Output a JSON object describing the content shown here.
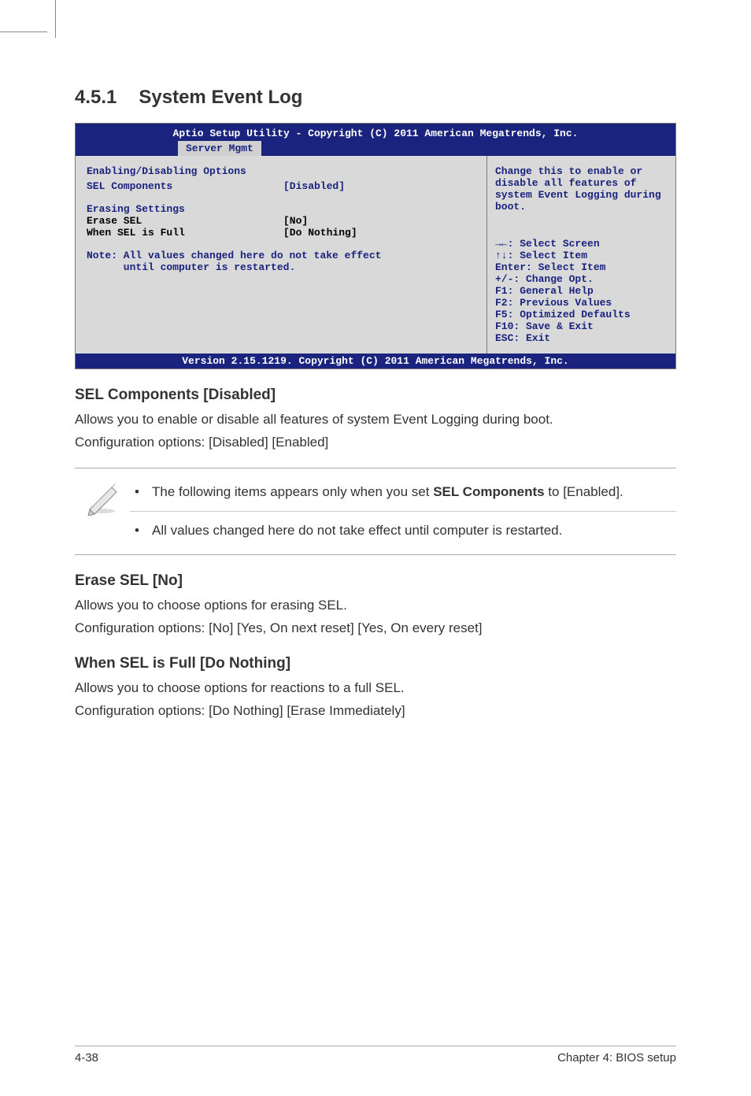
{
  "section": {
    "number": "4.5.1",
    "title": "System Event Log"
  },
  "bios": {
    "header_line1": "Aptio Setup Utility - Copyright (C) 2011 American Megatrends, Inc.",
    "tab": "Server Mgmt",
    "left": {
      "heading1": "Enabling/Disabling Options",
      "row1_label": "SEL Components",
      "row1_value": "[Disabled]",
      "heading2": "Erasing Settings",
      "row2_label": "Erase SEL",
      "row2_value": "[No]",
      "row3_label": "When SEL is Full",
      "row3_value": "[Do Nothing]",
      "note_line1": "Note: All values changed here do not take effect",
      "note_line2": "      until computer is restarted."
    },
    "right_top": "Change this to enable or disable all features of system Event Logging during boot.",
    "right_help": {
      "l1": "→←: Select Screen",
      "l2": "↑↓:  Select Item",
      "l3": "Enter: Select Item",
      "l4": "+/-: Change Opt.",
      "l5": "F1: General Help",
      "l6": "F2: Previous Values",
      "l7": "F5: Optimized Defaults",
      "l8": "F10: Save & Exit",
      "l9": "ESC: Exit"
    },
    "footer": "Version 2.15.1219. Copyright (C) 2011 American Megatrends, Inc."
  },
  "sub1": {
    "title": "SEL Components [Disabled]",
    "p1": "Allows you to enable or disable all features of system Event Logging during boot.",
    "p2": "Configuration options: [Disabled] [Enabled]"
  },
  "note": {
    "li1a": "The following items appears only when you set ",
    "li1b": "SEL Components",
    "li1c": " to [Enabled].",
    "li2": "All values changed here do not take effect until computer is restarted."
  },
  "sub2": {
    "title": "Erase SEL [No]",
    "p1": "Allows you to choose options for erasing SEL.",
    "p2": "Configuration options: [No] [Yes, On next reset] [Yes, On every reset]"
  },
  "sub3": {
    "title": "When SEL is Full [Do Nothing]",
    "p1": "Allows you to choose options for reactions to a full SEL.",
    "p2": "Configuration options: [Do Nothing] [Erase Immediately]"
  },
  "footer": {
    "left": "4-38",
    "right": "Chapter 4: BIOS setup"
  }
}
